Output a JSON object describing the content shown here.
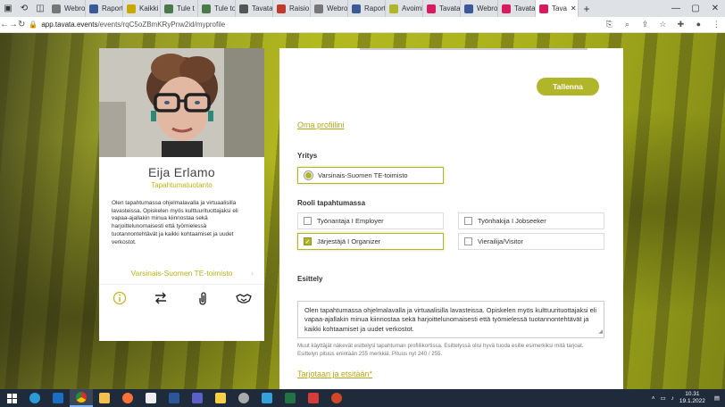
{
  "browser": {
    "tabs": [
      {
        "label": "Webro",
        "color": "#777"
      },
      {
        "label": "Raport",
        "color": "#3b5998"
      },
      {
        "label": "Kaikki t",
        "color": "#c9a800"
      },
      {
        "label": "Tule t",
        "color": "#4a7a4a"
      },
      {
        "label": "Tule to",
        "color": "#4a7a4a"
      },
      {
        "label": "Tavata",
        "color": "#555"
      },
      {
        "label": "Raisio",
        "color": "#c0392b"
      },
      {
        "label": "Webro",
        "color": "#777"
      },
      {
        "label": "Raport",
        "color": "#3b5998"
      },
      {
        "label": "Avoimi",
        "color": "#b0b52a"
      },
      {
        "label": "Tavata",
        "color": "#d81b60"
      },
      {
        "label": "Webro",
        "color": "#3b5998"
      },
      {
        "label": "Tavata",
        "color": "#d81b60"
      },
      {
        "label": "Tava",
        "color": "#d81b60",
        "active": true
      }
    ],
    "url_host": "app.tavata.events",
    "url_path": "/events/rqC5oZBmKRyPnw2id/myprofile"
  },
  "profile": {
    "name": "Eija Erlamo",
    "title": "Tapahtumatuotanto",
    "bio": "Olen tapahtumassa ohjelmalavalla ja virtuaalisilla lavasteissa. Opiskelen myös kulttuurituottajaksi eli vapaa-ajallakin minua kiinnostaa sekä harjoittelunomaisesti että työmielessä tuotannontehtävät ja kaikki kohtaamiset ja uudet verkostot.",
    "organization": "Varsinais-Suomen TE-toimisto"
  },
  "form": {
    "save_label": "Tallenna",
    "own_profile_link": "Oma profiilini",
    "company_label": "Yritys",
    "company_value": "Varsinais-Suomen TE-toimisto",
    "role_label": "Rooli tapahtumassa",
    "roles": [
      {
        "label": "Työnantaja I Employer",
        "checked": false
      },
      {
        "label": "Työnhakija I Jobseeker",
        "checked": false
      },
      {
        "label": "Järjestäjä I Organizer",
        "checked": true
      },
      {
        "label": "Vierailija/Visitor",
        "checked": false
      }
    ],
    "intro_label": "Esittely",
    "intro_text": "Olen tapahtumassa ohjelmalavalla ja virtuaalisilla lavasteissa. Opiskelen myös kulttuurituottajaksi eli vapaa-ajallakin minua kiinnostaa sekä harjoittelunomaisesti että työmielessä tuotannontehtävät ja kaikki kohtaamiset ja uudet verkostot.",
    "intro_hint": "Muut käyttäjät näkevät esittelysi tapahtuman profiilikortissa. Esittelyssä olisi hyvä tuoda esille esimerkiksi mitä tarjoat. Esittelyn pituus enintään 255 merkkiä. Pituus nyt  240 / 255.",
    "offers_link": "Tarjotaan ja etsitään*"
  },
  "taskbar": {
    "time": "10.31",
    "date": "19.1.2022"
  },
  "colors": {
    "accent": "#b0b52a",
    "link": "#b5a71b"
  }
}
